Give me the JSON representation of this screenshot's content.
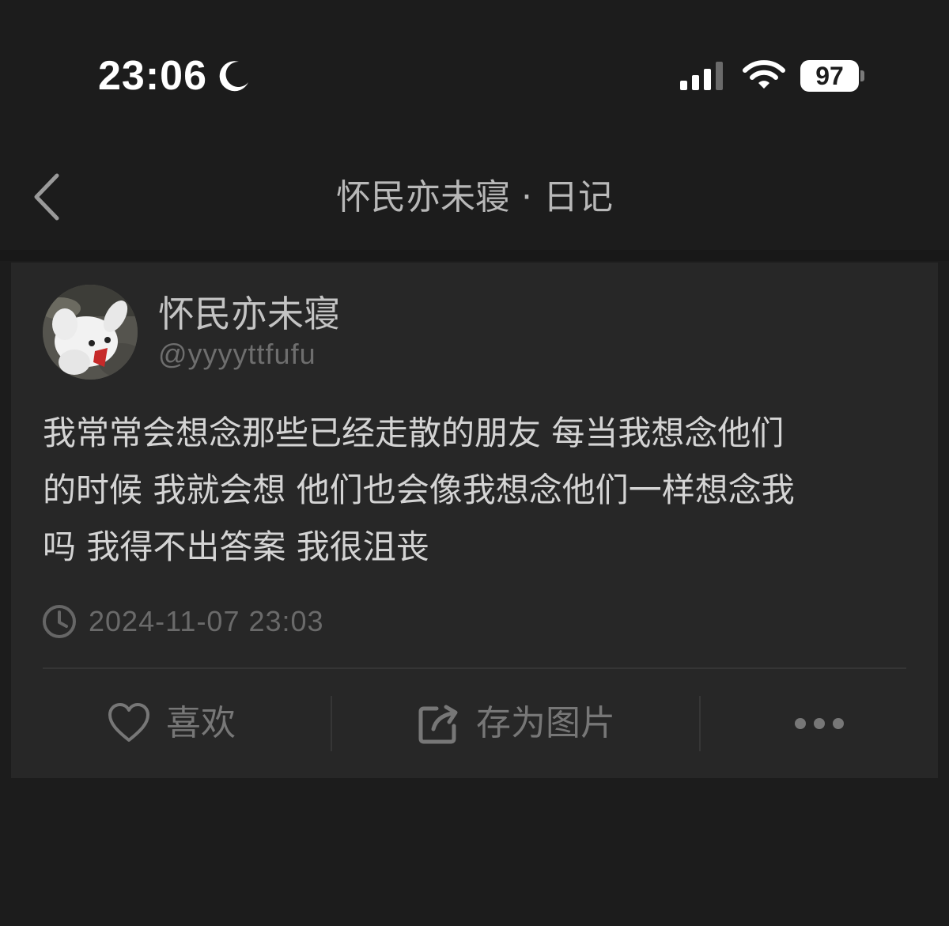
{
  "status_bar": {
    "time": "23:06",
    "battery": "97",
    "icons": [
      "moon-icon",
      "signal-icon",
      "wifi-icon",
      "battery-icon"
    ]
  },
  "nav": {
    "back_icon": "chevron-left-icon",
    "title": "怀民亦未寝 · 日记"
  },
  "post": {
    "author": {
      "name": "怀民亦未寝",
      "handle": "@yyyyttfufu"
    },
    "content": "我常常会想念那些已经走散的朋友 每当我想念他们\n的时候 我就会想 他们也会像我想念他们一样想念我\n吗 我得不出答案 我很沮丧",
    "timestamp": "2024-11-07 23:03"
  },
  "actions": {
    "like_label": "喜欢",
    "save_label": "存为图片",
    "icons": [
      "heart-icon",
      "share-image-icon",
      "more-icon"
    ]
  },
  "colors": {
    "background": "#1c1c1c",
    "card": "#272727",
    "text_primary": "#d4d4d4",
    "text_muted": "#6e6e6e"
  }
}
